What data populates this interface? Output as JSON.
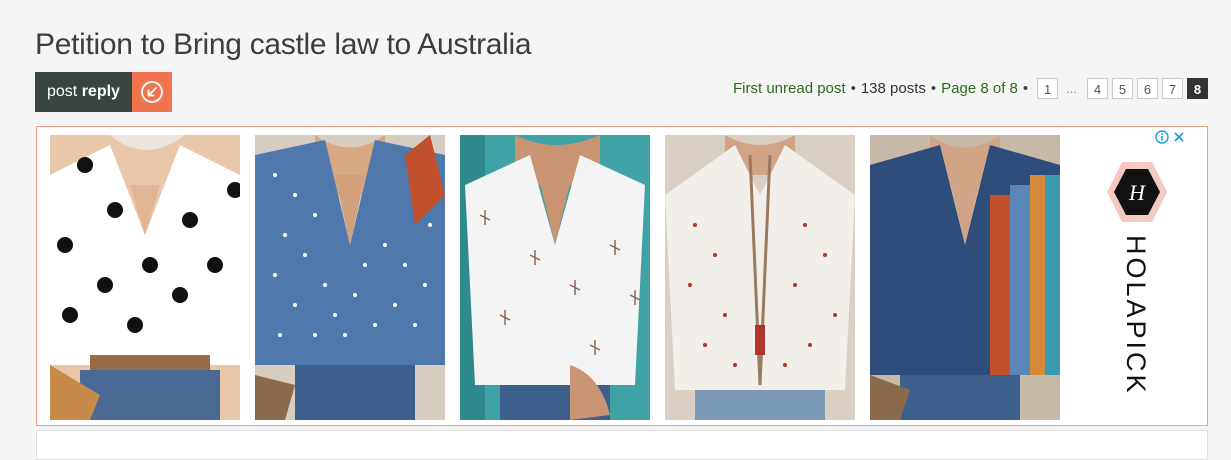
{
  "topic": {
    "title": "Petition to Bring castle law to Australia"
  },
  "actions": {
    "post_reply_prefix": "post",
    "post_reply_bold": "reply",
    "post_reply_icon": "reply-arrow-icon"
  },
  "pagination": {
    "first_unread": "First unread post",
    "posts_count": "138 posts",
    "page_info": "Page 8 of 8",
    "bullet": "•",
    "pages": [
      "1",
      "...",
      "4",
      "5",
      "6",
      "7",
      "8"
    ],
    "current": "8"
  },
  "ad": {
    "brand": "HOLAPICK",
    "info_icon": "info-icon",
    "close_icon": "close-icon",
    "items": [
      {
        "name": "white-polka-dot-blouse",
        "bg": "#ffffff",
        "dot": "#111111",
        "accent": "#c49a7a"
      },
      {
        "name": "blue-polka-dot-blouse",
        "bg": "#4f78ad",
        "dot": "#ffffff",
        "accent": "#c49a7a"
      },
      {
        "name": "white-dragonfly-blouse",
        "bg": "#f4f4f4",
        "dot": "#8a6a5a",
        "accent": "#3fa3a6"
      },
      {
        "name": "white-boho-blouse",
        "bg": "#f2efea",
        "dot": "#b0352a",
        "accent": "#9a7b62"
      },
      {
        "name": "navy-patchwork-blouse",
        "bg": "#2f4d7a",
        "dot": "#5a86b8",
        "accent": "#c2512e"
      }
    ]
  }
}
